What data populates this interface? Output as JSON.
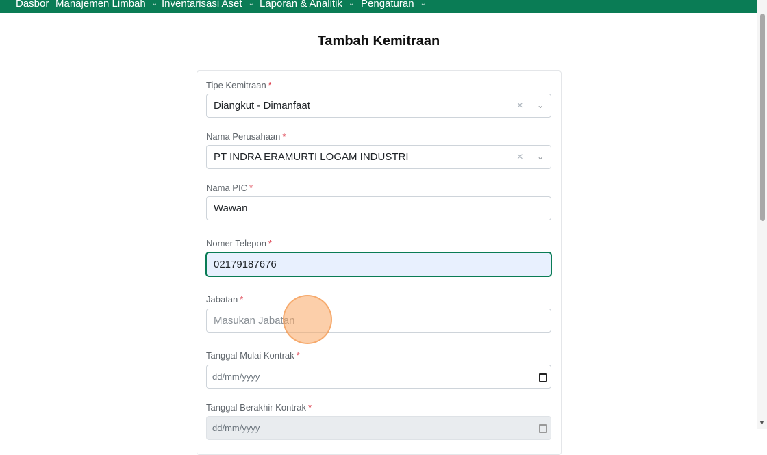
{
  "nav": {
    "items": [
      {
        "label": "Dasbor",
        "dropdown": false
      },
      {
        "label": "Manajemen Limbah",
        "dropdown": true
      },
      {
        "label": "Inventarisasi Aset",
        "dropdown": true
      },
      {
        "label": "Laporan & Analitik",
        "dropdown": true
      },
      {
        "label": "Pengaturan",
        "dropdown": true
      }
    ],
    "chevron_glyph": "⌄"
  },
  "page": {
    "title": "Tambah Kemitraan"
  },
  "required_mark": "*",
  "form": {
    "tipe": {
      "label": "Tipe Kemitraan",
      "value": "Diangkut - Dimanfaat"
    },
    "perusahaan": {
      "label": "Nama Perusahaan",
      "value": "PT INDRA ERAMURTI LOGAM INDUSTRI"
    },
    "pic": {
      "label": "Nama PIC",
      "value": "Wawan"
    },
    "telepon": {
      "label": "Nomer Telepon",
      "value": "02179187676"
    },
    "jabatan": {
      "label": "Jabatan",
      "placeholder": "Masukan Jabatan"
    },
    "mulai": {
      "label": "Tanggal Mulai Kontrak",
      "placeholder": "dd/mm/yyyy"
    },
    "berakhir": {
      "label": "Tanggal Berakhir Kontrak",
      "placeholder": "dd/mm/yyyy"
    }
  },
  "icons": {
    "clear": "×",
    "chevron": "⌄",
    "calendar": "calendar-icon"
  },
  "colors": {
    "nav_bg": "#0a7c55",
    "required": "#dc3545",
    "focus_bg": "#e8f0fe"
  }
}
